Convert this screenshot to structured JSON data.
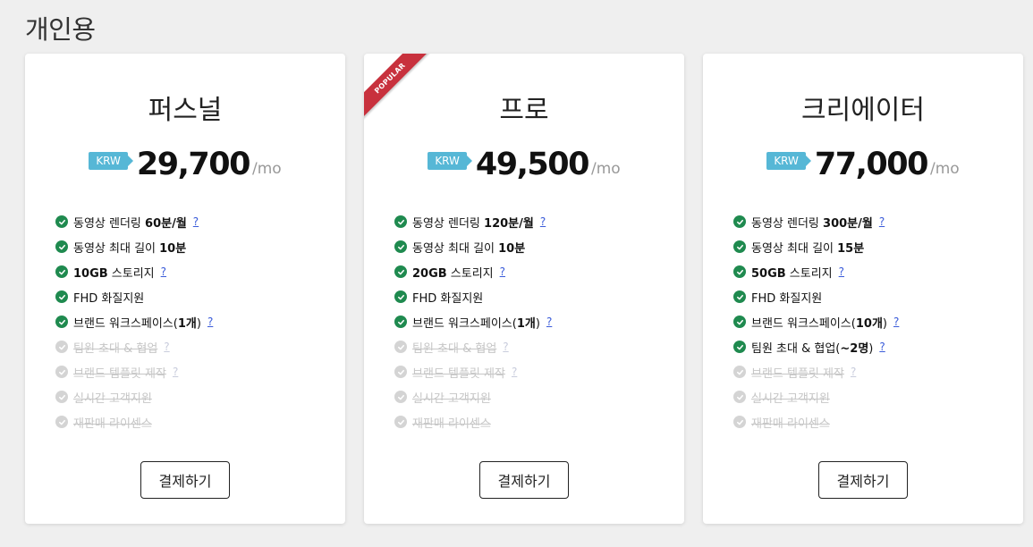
{
  "section_title": "개인용",
  "ribbon_label": "POPULAR",
  "currency": "KRW",
  "period": "/mo",
  "button_label": "결제하기",
  "colors": {
    "check_on": "#1f8a4f",
    "check_off": "#d4d4d4",
    "currency_badge": "#56b7d6",
    "ribbon": "#c8313d",
    "help_link": "#3a5bd9"
  },
  "plans": [
    {
      "name": "퍼스널",
      "price": "29,700",
      "popular": false,
      "features": [
        {
          "parts": [
            "동영상 렌더링 ",
            {
              "b": "60분/월"
            }
          ],
          "help": "?",
          "enabled": true
        },
        {
          "parts": [
            "동영상 최대 길이 ",
            {
              "b": "10분"
            }
          ],
          "help": "",
          "enabled": true
        },
        {
          "parts": [
            {
              "b": "10GB"
            },
            " 스토리지"
          ],
          "help": "?",
          "enabled": true
        },
        {
          "parts": [
            "FHD 화질지원"
          ],
          "help": "",
          "enabled": true
        },
        {
          "parts": [
            "브랜드 워크스페이스(",
            {
              "b": "1개"
            },
            ")"
          ],
          "help": "?",
          "enabled": true
        },
        {
          "parts": [
            "팀원 초대 & 협업"
          ],
          "help": "?",
          "enabled": false
        },
        {
          "parts": [
            "브랜드 템플릿 제작"
          ],
          "help": "?",
          "enabled": false
        },
        {
          "parts": [
            "실시간 고객지원"
          ],
          "help": "",
          "enabled": false
        },
        {
          "parts": [
            "재판매 라이센스"
          ],
          "help": "",
          "enabled": false
        }
      ]
    },
    {
      "name": "프로",
      "price": "49,500",
      "popular": true,
      "features": [
        {
          "parts": [
            "동영상 렌더링 ",
            {
              "b": "120분/월"
            }
          ],
          "help": "?",
          "enabled": true
        },
        {
          "parts": [
            "동영상 최대 길이 ",
            {
              "b": "10분"
            }
          ],
          "help": "",
          "enabled": true
        },
        {
          "parts": [
            {
              "b": "20GB"
            },
            " 스토리지"
          ],
          "help": "?",
          "enabled": true
        },
        {
          "parts": [
            "FHD 화질지원"
          ],
          "help": "",
          "enabled": true
        },
        {
          "parts": [
            "브랜드 워크스페이스(",
            {
              "b": "1개"
            },
            ")"
          ],
          "help": "?",
          "enabled": true
        },
        {
          "parts": [
            "팀원 초대 & 협업"
          ],
          "help": "?",
          "enabled": false
        },
        {
          "parts": [
            "브랜드 템플릿 제작"
          ],
          "help": "?",
          "enabled": false
        },
        {
          "parts": [
            "실시간 고객지원"
          ],
          "help": "",
          "enabled": false
        },
        {
          "parts": [
            "재판매 라이센스"
          ],
          "help": "",
          "enabled": false
        }
      ]
    },
    {
      "name": "크리에이터",
      "price": "77,000",
      "popular": false,
      "features": [
        {
          "parts": [
            "동영상 렌더링 ",
            {
              "b": "300분/월"
            }
          ],
          "help": "?",
          "enabled": true
        },
        {
          "parts": [
            "동영상 최대 길이 ",
            {
              "b": "15분"
            }
          ],
          "help": "",
          "enabled": true
        },
        {
          "parts": [
            {
              "b": "50GB"
            },
            " 스토리지"
          ],
          "help": "?",
          "enabled": true
        },
        {
          "parts": [
            "FHD 화질지원"
          ],
          "help": "",
          "enabled": true
        },
        {
          "parts": [
            "브랜드 워크스페이스(",
            {
              "b": "10개"
            },
            ")"
          ],
          "help": "?",
          "enabled": true
        },
        {
          "parts": [
            "팀원 초대 & 협업(",
            {
              "b": "~2명"
            },
            ")"
          ],
          "help": "?",
          "enabled": true
        },
        {
          "parts": [
            "브랜드 템플릿 제작"
          ],
          "help": "?",
          "enabled": false
        },
        {
          "parts": [
            "실시간 고객지원"
          ],
          "help": "",
          "enabled": false
        },
        {
          "parts": [
            "재판매 라이센스"
          ],
          "help": "",
          "enabled": false
        }
      ]
    }
  ]
}
